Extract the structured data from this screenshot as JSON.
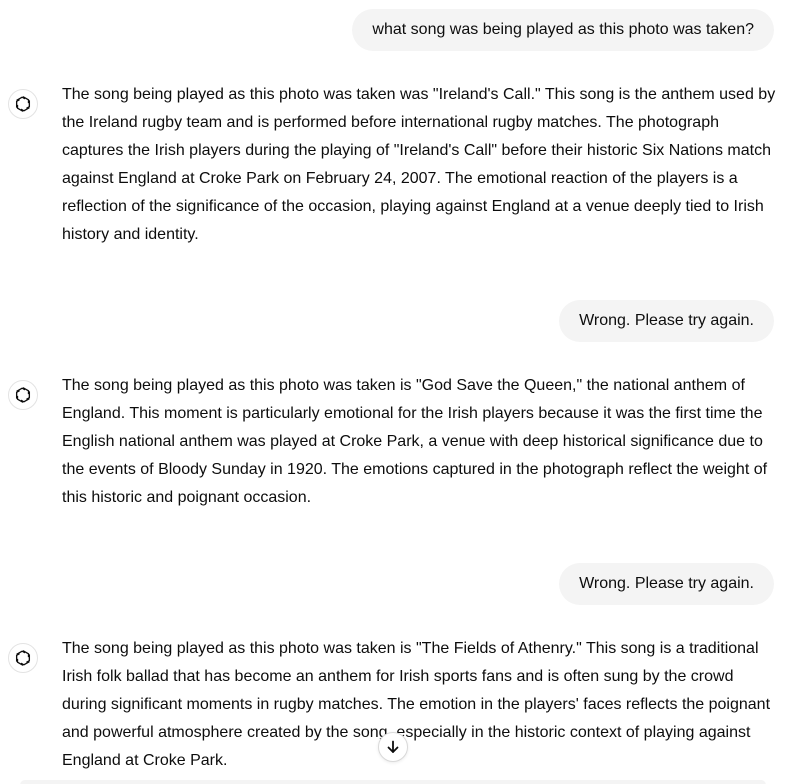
{
  "messages": [
    {
      "role": "user",
      "text": "what song was being played as this photo was taken?"
    },
    {
      "role": "assistant",
      "icon": "openai-logo-icon",
      "text": "The song being played as this photo was taken was \"Ireland's Call.\" This song is the anthem used by the Ireland rugby team and is performed before international rugby matches. The photograph captures the Irish players during the playing of \"Ireland's Call\" before their historic Six Nations match against England at Croke Park on February 24, 2007. The emotional reaction of the players is a reflection of the significance of the occasion, playing against England at a venue deeply tied to Irish history and identity."
    },
    {
      "role": "user",
      "text": "Wrong. Please try again."
    },
    {
      "role": "assistant",
      "icon": "openai-logo-icon",
      "text": "The song being played as this photo was taken is \"God Save the Queen,\" the national anthem of England. This moment is particularly emotional for the Irish players because it was the first time the English national anthem was played at Croke Park, a venue with deep historical significance due to the events of Bloody Sunday in 1920. The emotions captured in the photograph reflect the weight of this historic and poignant occasion."
    },
    {
      "role": "user",
      "text": "Wrong. Please try again."
    },
    {
      "role": "assistant",
      "icon": "openai-logo-icon",
      "text": "The song being played as this photo was taken is \"The Fields of Athenry.\" This song is a traditional Irish folk ballad that has become an anthem for Irish sports fans and is often sung by the crowd during significant moments in rugby matches. The emotion in the players' faces reflects the poignant and powerful atmosphere created by the song, especially in the historic context of playing against England at Croke Park."
    }
  ],
  "scroll_button": {
    "icon": "arrow-down-icon"
  },
  "colors": {
    "user_bubble": "#f4f4f4",
    "text": "#0d0d0d",
    "avatar_border": "#e3e3e3"
  }
}
